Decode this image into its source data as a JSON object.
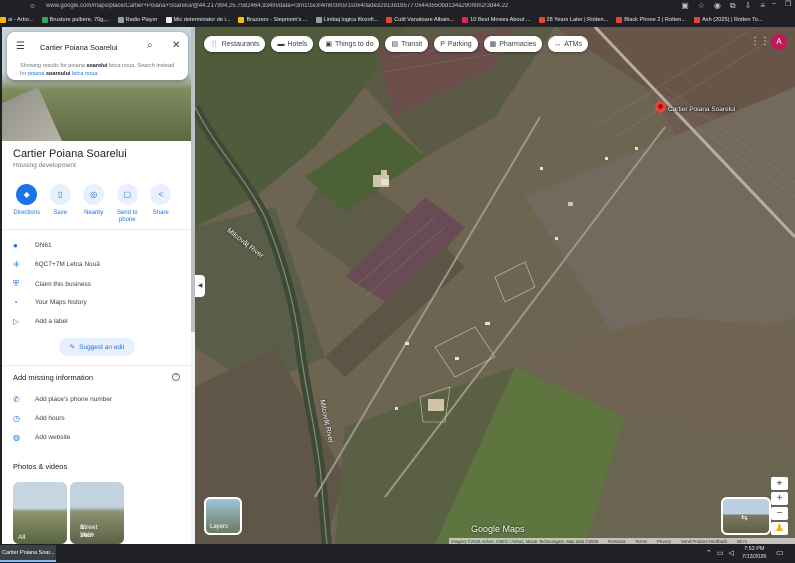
{
  "browser": {
    "url": "www.google.com/maps/place/Cartier+Poiana+Soarelui/@44.217994,25.7582464,934m/data=!3m1!1e3!4m6!3m5!1s0x40ade32913d1b577:0x443550bd134a290!8m2!3d44.22",
    "bookmarks": [
      {
        "label": "ai - Arbo...",
        "color": "#fbbc04"
      },
      {
        "label": "Brusture pulbere, 70g,...",
        "color": "#34a853"
      },
      {
        "label": "Radio Player",
        "color": "#9aa0a6"
      },
      {
        "label": "Mic determinator de i...",
        "color": "#e8eaed"
      },
      {
        "label": "Brazzers - Stepmom's ...",
        "color": "#fbbc04"
      },
      {
        "label": "Limbaj logica filozofi...",
        "color": "#9aa0a6"
      },
      {
        "label": "Cutit Vanatoare Albain...",
        "color": "#ea4335"
      },
      {
        "label": "10 Best Movies About ...",
        "color": "#e91e63"
      },
      {
        "label": "28 Years Later | Rotten...",
        "color": "#ea4335"
      },
      {
        "label": "Black Phone 2 | Rotten...",
        "color": "#ea4335"
      },
      {
        "label": "Ash (2025) | Rotten To...",
        "color": "#ea4335"
      }
    ]
  },
  "search": {
    "query": "Cartier Poiana Soarelui",
    "showing_prefix": "Showing results for poiana ",
    "showing_bold": "soarelui",
    "showing_mid": " letca noua. Search instead for ",
    "showing_link_a": "poiana ",
    "showing_link_b": "soareului",
    "showing_link_c": " letca noua"
  },
  "place": {
    "name": "Cartier Poiana Soarelui",
    "category": "Housing development"
  },
  "actions": [
    {
      "label": "Directions",
      "icon": "◆"
    },
    {
      "label": "Save",
      "icon": "▯"
    },
    {
      "label": "Nearby",
      "icon": "◎"
    },
    {
      "label": "Send to phone",
      "icon": "▢"
    },
    {
      "label": "Share",
      "icon": "<"
    }
  ],
  "info": {
    "address": "DN61",
    "plus_code": "6QC7+7M Letca Nouă",
    "claim": "Claim this business",
    "history": "Your Maps history",
    "label": "Add a label"
  },
  "suggest_edit": "Suggest an edit",
  "missing": {
    "title": "Add missing information",
    "phone": "Add place's phone number",
    "hours": "Add hours",
    "website": "Add website"
  },
  "photos": {
    "title": "Photos & videos",
    "all": "All",
    "street_view_a": "Street View",
    "street_view_b": "& 360°"
  },
  "chips": [
    {
      "label": "Restaurants",
      "icon": "🍴"
    },
    {
      "label": "Hotels",
      "icon": "▬"
    },
    {
      "label": "Things to do",
      "icon": "▣"
    },
    {
      "label": "Transit",
      "icon": "▤"
    },
    {
      "label": "Parking",
      "icon": "P"
    },
    {
      "label": "Pharmacies",
      "icon": "▦"
    },
    {
      "label": "ATMs",
      "icon": "↔"
    }
  ],
  "map": {
    "pin_label": "Cartier Poiana Soarelui",
    "river_a": "Milcovăț River",
    "river_b": "Milcovăț River",
    "layers": "Layers",
    "logo": "Google Maps",
    "imagery": "Imagery ©2026 Airbus, CNES / Airbus, Maxar Technologies, Map data ©2026",
    "romania": "Romania",
    "terms": "Terms",
    "privacy": "Privacy",
    "feedback": "Send Product Feedback",
    "scale": "50 m",
    "avatar": "A"
  },
  "taskbar": {
    "item": "Cartier Poiana Soar...",
    "time": "7:53 PM",
    "date": "7/13/2026"
  }
}
